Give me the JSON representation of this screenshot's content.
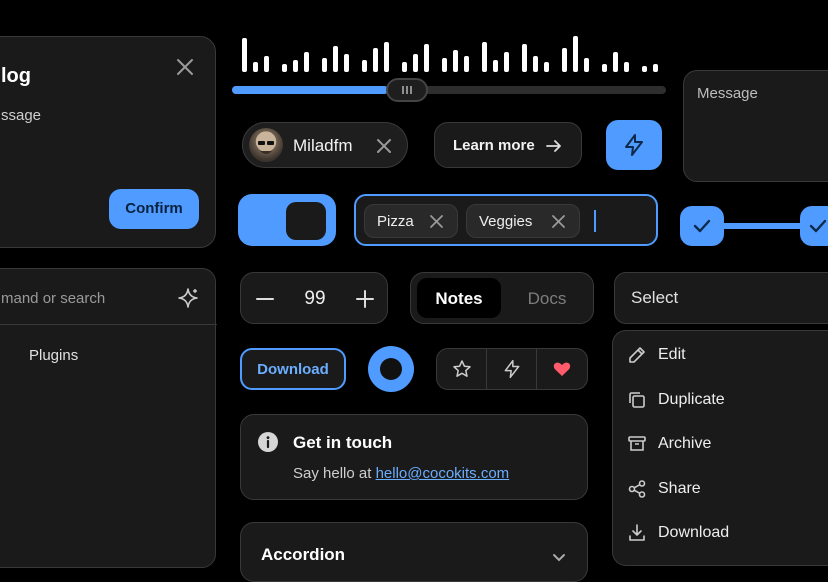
{
  "dialog": {
    "title": "log",
    "message": "ssage",
    "confirm_label": "Confirm"
  },
  "slider": {
    "value": 0.36
  },
  "message_field": {
    "placeholder": "Message"
  },
  "chip": {
    "name": "Miladfm"
  },
  "learn_more": {
    "label": "Learn more"
  },
  "tags": {
    "items": [
      "Pizza",
      "Veggies"
    ]
  },
  "stepper": {
    "value": "99"
  },
  "segmented": {
    "items": [
      "Notes",
      "Docs"
    ],
    "selected": "Notes"
  },
  "select": {
    "placeholder": "Select"
  },
  "command": {
    "placeholder": "mand or search",
    "item": "Plugins"
  },
  "download_button": {
    "label": "Download"
  },
  "menu": {
    "items": [
      {
        "label": "Edit",
        "icon": "edit-icon"
      },
      {
        "label": "Duplicate",
        "icon": "duplicate-icon"
      },
      {
        "label": "Archive",
        "icon": "archive-icon"
      },
      {
        "label": "Share",
        "icon": "share-icon"
      },
      {
        "label": "Download",
        "icon": "download-icon"
      }
    ]
  },
  "alert": {
    "title": "Get in touch",
    "text_prefix": "Say hello at ",
    "email": "hello@cocokits.com"
  },
  "accordion": {
    "title": "Accordion"
  },
  "colors": {
    "accent": "#4f9bff",
    "bg": "#000000",
    "card": "#1b1a1a",
    "border": "#3a3939",
    "heart": "#ff5b6b"
  }
}
